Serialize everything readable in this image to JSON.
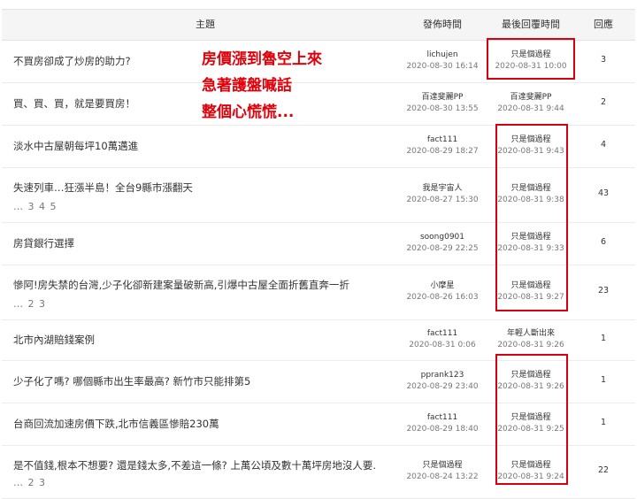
{
  "header": {
    "topic": "主題",
    "post_time": "發佈時間",
    "last_reply_time": "最後回覆時間",
    "replies": "回應"
  },
  "rows": [
    {
      "title": "不買房卻成了炒房的助力?",
      "pages": "",
      "author": "lichujen",
      "post_date": "2020-08-30 16:14",
      "last_user": "只是個過程",
      "last_date": "2020-08-31 10:00",
      "replies": "3"
    },
    {
      "title": "買、買、買，就是要買房！",
      "pages": "",
      "author": "百達斐麗PP",
      "post_date": "2020-08-30 13:55",
      "last_user": "百達斐麗PP",
      "last_date": "2020-08-31 9:44",
      "replies": "2"
    },
    {
      "title": "淡水中古屋朝每坪10萬邁進",
      "pages": "",
      "author": "fact111",
      "post_date": "2020-08-29 18:27",
      "last_user": "只是個過程",
      "last_date": "2020-08-31 9:43",
      "replies": "4"
    },
    {
      "title": "失速列車…狂漲半島！全台9縣市漲翻天",
      "pages": "… 3 4 5",
      "author": "我是宇宙人",
      "post_date": "2020-08-27 15:30",
      "last_user": "只是個過程",
      "last_date": "2020-08-31 9:38",
      "replies": "43"
    },
    {
      "title": "房貸銀行選擇",
      "pages": "",
      "author": "soong0901",
      "post_date": "2020-08-29 22:25",
      "last_user": "只是個過程",
      "last_date": "2020-08-31 9:33",
      "replies": "6"
    },
    {
      "title": "慘阿!房失禁的台灣,少子化卻新建案量破新高,引爆中古屋全面折舊直奔一折",
      "pages": "… 2 3",
      "author": "小摩星",
      "post_date": "2020-08-26 16:03",
      "last_user": "只是個過程",
      "last_date": "2020-08-31 9:27",
      "replies": "23"
    },
    {
      "title": "北市內湖賠錢案例",
      "pages": "",
      "author": "fact111",
      "post_date": "2020-08-31 0:06",
      "last_user": "年輕人斷出來",
      "last_date": "2020-08-31 9:26",
      "replies": "1"
    },
    {
      "title": "少子化了嗎? 哪個縣市出生率最高? 新竹市只能排第5",
      "pages": "",
      "author": "pprank123",
      "post_date": "2020-08-29 23:40",
      "last_user": "只是個過程",
      "last_date": "2020-08-31 9:26",
      "replies": "1"
    },
    {
      "title": "台商回流加速房價下跌,北市信義區慘賠230萬",
      "pages": "",
      "author": "fact111",
      "post_date": "2020-08-29 18:40",
      "last_user": "只是個過程",
      "last_date": "2020-08-31 9:25",
      "replies": "1"
    },
    {
      "title": "是不值錢,根本不想要? 還是錢太多,不差這一條? 上萬公頃及數十萬坪房地沒人要.",
      "pages": "… 2 3",
      "author": "只是個過程",
      "post_date": "2020-08-24 13:22",
      "last_user": "只是個過程",
      "last_date": "2020-08-31 9:24",
      "replies": "22"
    }
  ],
  "overlay": {
    "line1": "房價漲到魯空上來",
    "line2": "急著護盤喊話",
    "line3": "整個心慌慌..."
  },
  "colors": {
    "annotation_red": "#d8000f",
    "header_bg": "#f5f5f5"
  }
}
